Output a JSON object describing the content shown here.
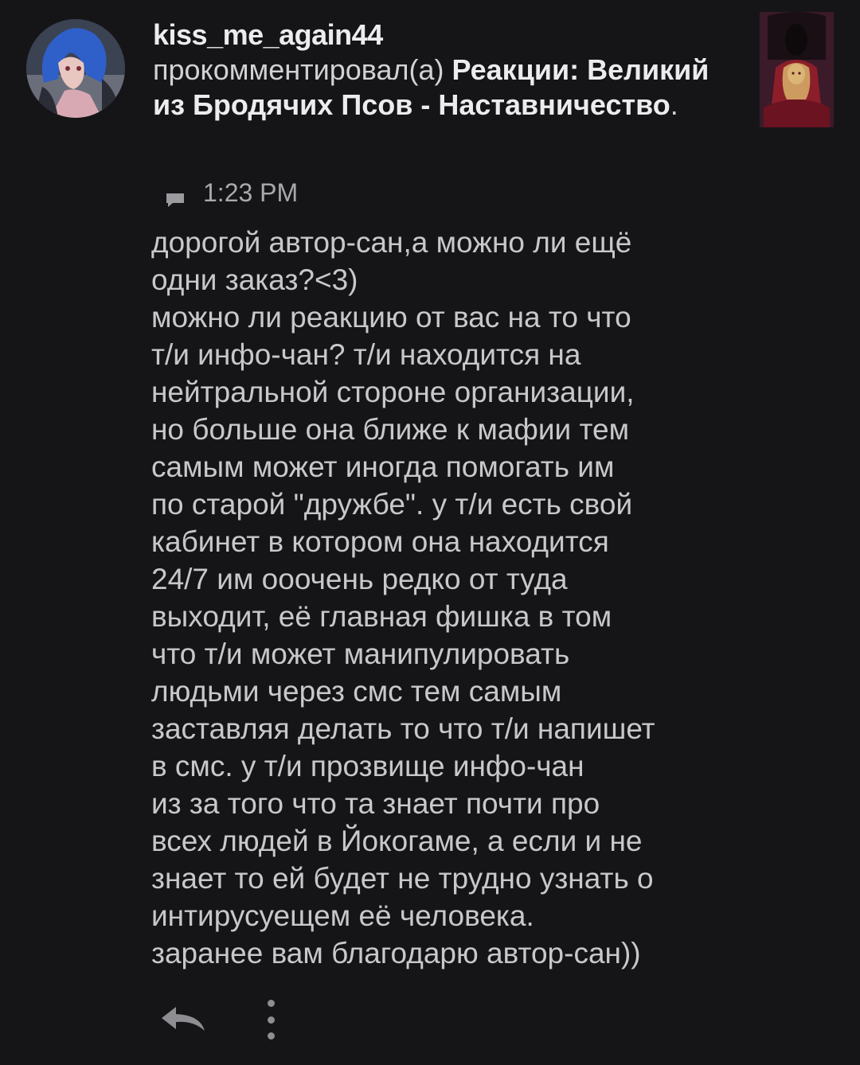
{
  "notification": {
    "username": "kiss_me_again44",
    "action": "прокомментировал(а) ",
    "post_title": "Реакции: Великий из Бродячих Псов - Наставничество",
    "title_suffix": ".",
    "time": "1:23 PM",
    "comment_lines": [
      "дорогой автор-сан,а можно ли ещё",
      "одни заказ?<3)",
      "можно ли реакцию от вас на то что",
      "т/и инфо-чан? т/и находится на",
      "нейтральной стороне организации,",
      "но больше она ближе к мафии тем",
      "самым может иногда помогать им",
      "по старой \"дружбе\". у т/и есть свой",
      "кабинет в котором она находится",
      "24/7 им ооочень редко от туда",
      "выходит, её главная фишка в том",
      "что т/и может манипулировать",
      "людьми через смс тем самым",
      "заставляя делать то что т/и напишет",
      "в смс. у т/и прозвище инфо-чан",
      "из за того что та знает почти про",
      "всех людей в Йокогаме, а если и не",
      "знает то ей будет не трудно узнать о",
      "интирусуещем её человека.",
      "заранее вам благодарю автор-сан))"
    ]
  },
  "icons": {
    "avatar": "user-avatar",
    "thumbnail": "post-thumbnail",
    "comment": "comment-icon",
    "reply": "reply-icon",
    "more": "more-vertical-icon"
  },
  "colors": {
    "background": "#151517",
    "text_primary": "#ececef",
    "text_body": "#c8c8cb",
    "text_muted": "#a9a9ad"
  }
}
